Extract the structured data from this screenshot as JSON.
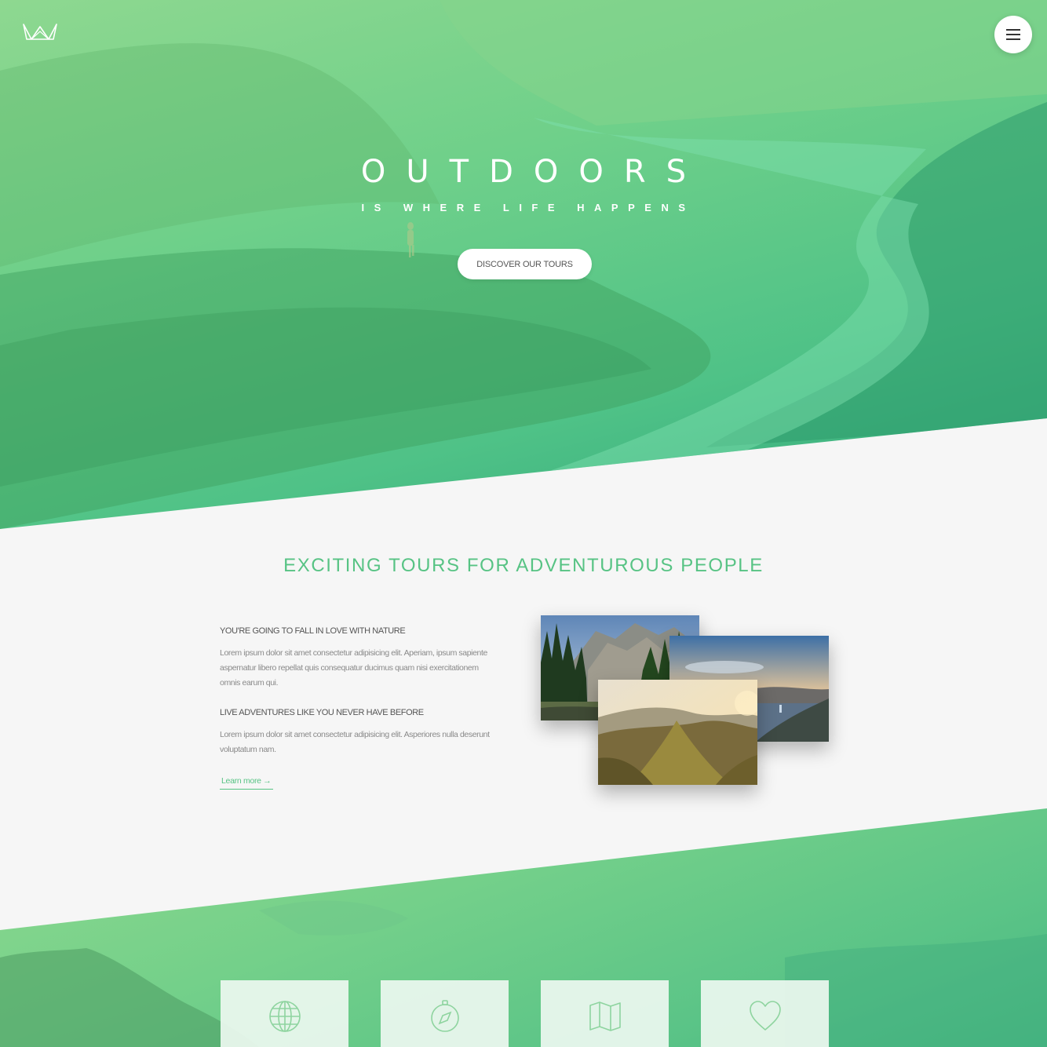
{
  "header": {
    "logo_icon": "crown-logo-icon",
    "menu_icon": "hamburger-menu-icon"
  },
  "hero": {
    "title": "OUTDOORS",
    "subtitle": "IS WHERE LIFE HAPPENS",
    "cta_label": "DISCOVER OUR TOURS"
  },
  "tours_section": {
    "heading": "EXCITING TOURS FOR ADVENTUROUS PEOPLE",
    "items": [
      {
        "title": "YOU'RE GOING TO FALL IN LOVE WITH NATURE",
        "body": "Lorem ipsum dolor sit amet consectetur adipisicing elit. Aperiam, ipsum sapiente aspernatur libero repellat quis consequatur ducimus quam nisi exercitationem omnis earum qui."
      },
      {
        "title": "LIVE ADVENTURES LIKE YOU NEVER HAVE BEFORE",
        "body": "Lorem ipsum dolor sit amet consectetur adipisicing elit. Asperiores nulla deserunt voluptatum nam."
      }
    ],
    "link_label": "Learn more →"
  },
  "features": {
    "icons": [
      "globe-icon",
      "compass-icon",
      "map-icon",
      "heart-icon"
    ]
  },
  "colors": {
    "accent": "#57c384",
    "hero_light": "#8ed890",
    "hero_dark": "#2fa57a",
    "background": "#f6f6f6"
  }
}
